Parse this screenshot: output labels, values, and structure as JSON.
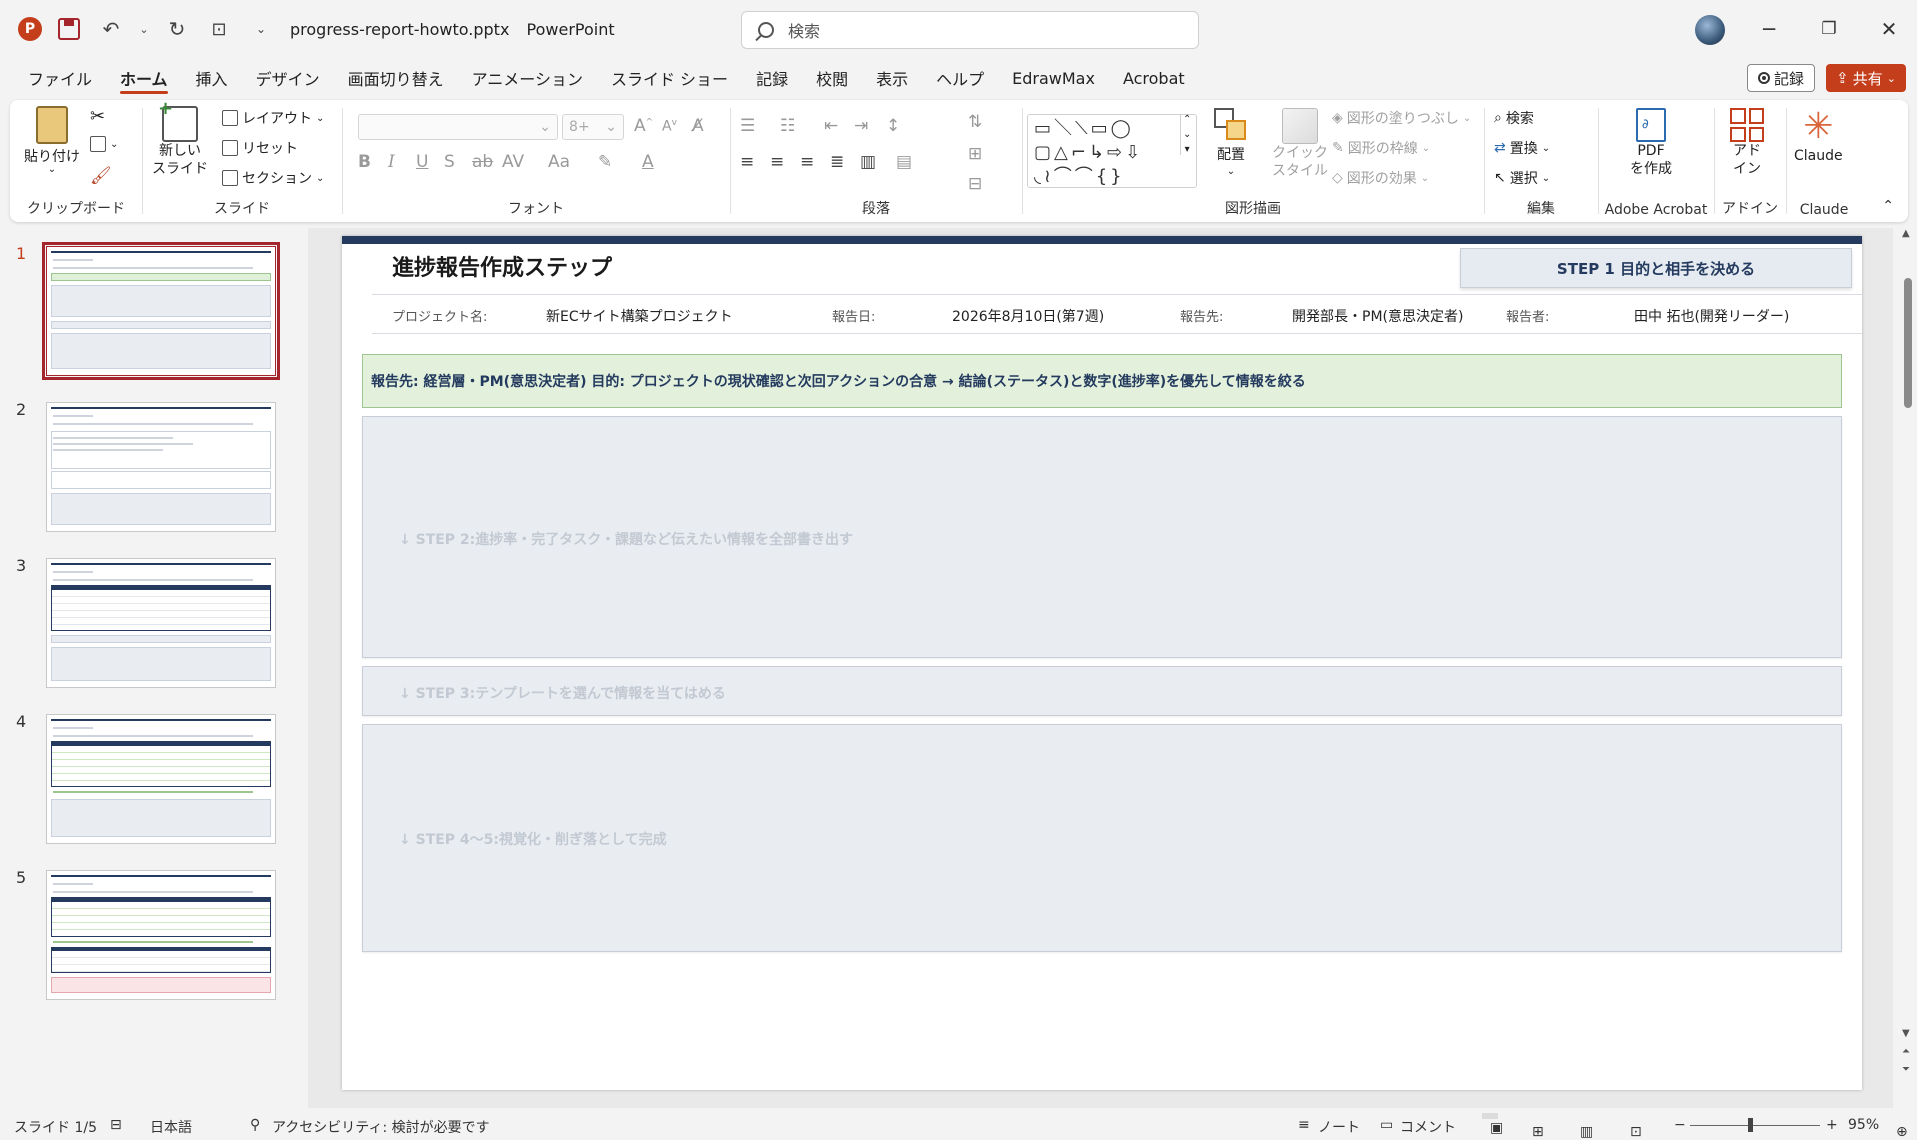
{
  "titlebar": {
    "logo_letter": "P",
    "filename": "progress-report-howto.pptx",
    "app_name": "PowerPoint",
    "search_placeholder": "検索",
    "minimize": "─",
    "restore": "❐",
    "close": "✕"
  },
  "menu": {
    "tabs": [
      "ファイル",
      "ホーム",
      "挿入",
      "デザイン",
      "画面切り替え",
      "アニメーション",
      "スライド ショー",
      "記録",
      "校閲",
      "表示",
      "ヘルプ",
      "EdrawMax",
      "Acrobat"
    ],
    "active_index": 1,
    "record_label": "記録",
    "share_label": "共有"
  },
  "ribbon": {
    "clipboard": {
      "label": "クリップボード",
      "paste": "貼り付け"
    },
    "slides": {
      "label": "スライド",
      "new_slide_1": "新しい",
      "new_slide_2": "スライド",
      "layout": "レイアウト",
      "reset": "リセット",
      "section": "セクション"
    },
    "font": {
      "label": "フォント",
      "size": "8+"
    },
    "paragraph": {
      "label": "段落"
    },
    "drawing": {
      "label": "図形描画",
      "arrange": "配置",
      "quick_style_1": "クイック",
      "quick_style_2": "スタイル",
      "fill": "図形の塗りつぶし",
      "outline": "図形の枠線",
      "effects": "図形の効果"
    },
    "editing": {
      "label": "編集",
      "find": "検索",
      "replace": "置換",
      "select": "選択"
    },
    "acrobat": {
      "label": "Adobe Acrobat",
      "pdf_1": "PDF",
      "pdf_2": "を作成"
    },
    "addin": {
      "label": "アドイン",
      "btn_1": "アド",
      "btn_2": "イン"
    },
    "claude": {
      "label": "Claude",
      "btn": "Claude"
    }
  },
  "thumbnails": [
    "1",
    "2",
    "3",
    "4",
    "5"
  ],
  "slide": {
    "title": "進捗報告作成ステップ",
    "step_badge": "STEP 1  目的と相手を決める",
    "info": {
      "project_label": "プロジェクト名:",
      "project_value": "新ECサイト構築プロジェクト",
      "date_label": "報告日:",
      "date_value": "2026年8月10日(第7週)",
      "to_label": "報告先:",
      "to_value": "開発部長・PM(意思決定者)",
      "reporter_label": "報告者:",
      "reporter_value": "田中 拓也(開発リーダー)"
    },
    "goal": "報告先: 経営層・PM(意思決定者)  目的: プロジェクトの現状確認と次回アクションの合意  → 結論(ステータス)と数字(進捗率)を優先して情報を絞る",
    "step2": "↓ STEP 2:進捗率・完了タスク・課題など伝えたい情報を全部書き出す",
    "step3": "↓ STEP 3:テンプレートを選んで情報を当てはめる",
    "step45": "↓ STEP 4〜5:視覚化・削ぎ落として完成"
  },
  "status": {
    "slide_count": "スライド 1/5",
    "language": "日本語",
    "accessibility": "アクセシビリティ: 検討が必要です",
    "notes": "ノート",
    "comments": "コメント",
    "zoom": "95%"
  },
  "colors": {
    "accent": "#c43e1c",
    "slide_navy": "#243a5e",
    "goal_green": "#e3f1dc"
  }
}
